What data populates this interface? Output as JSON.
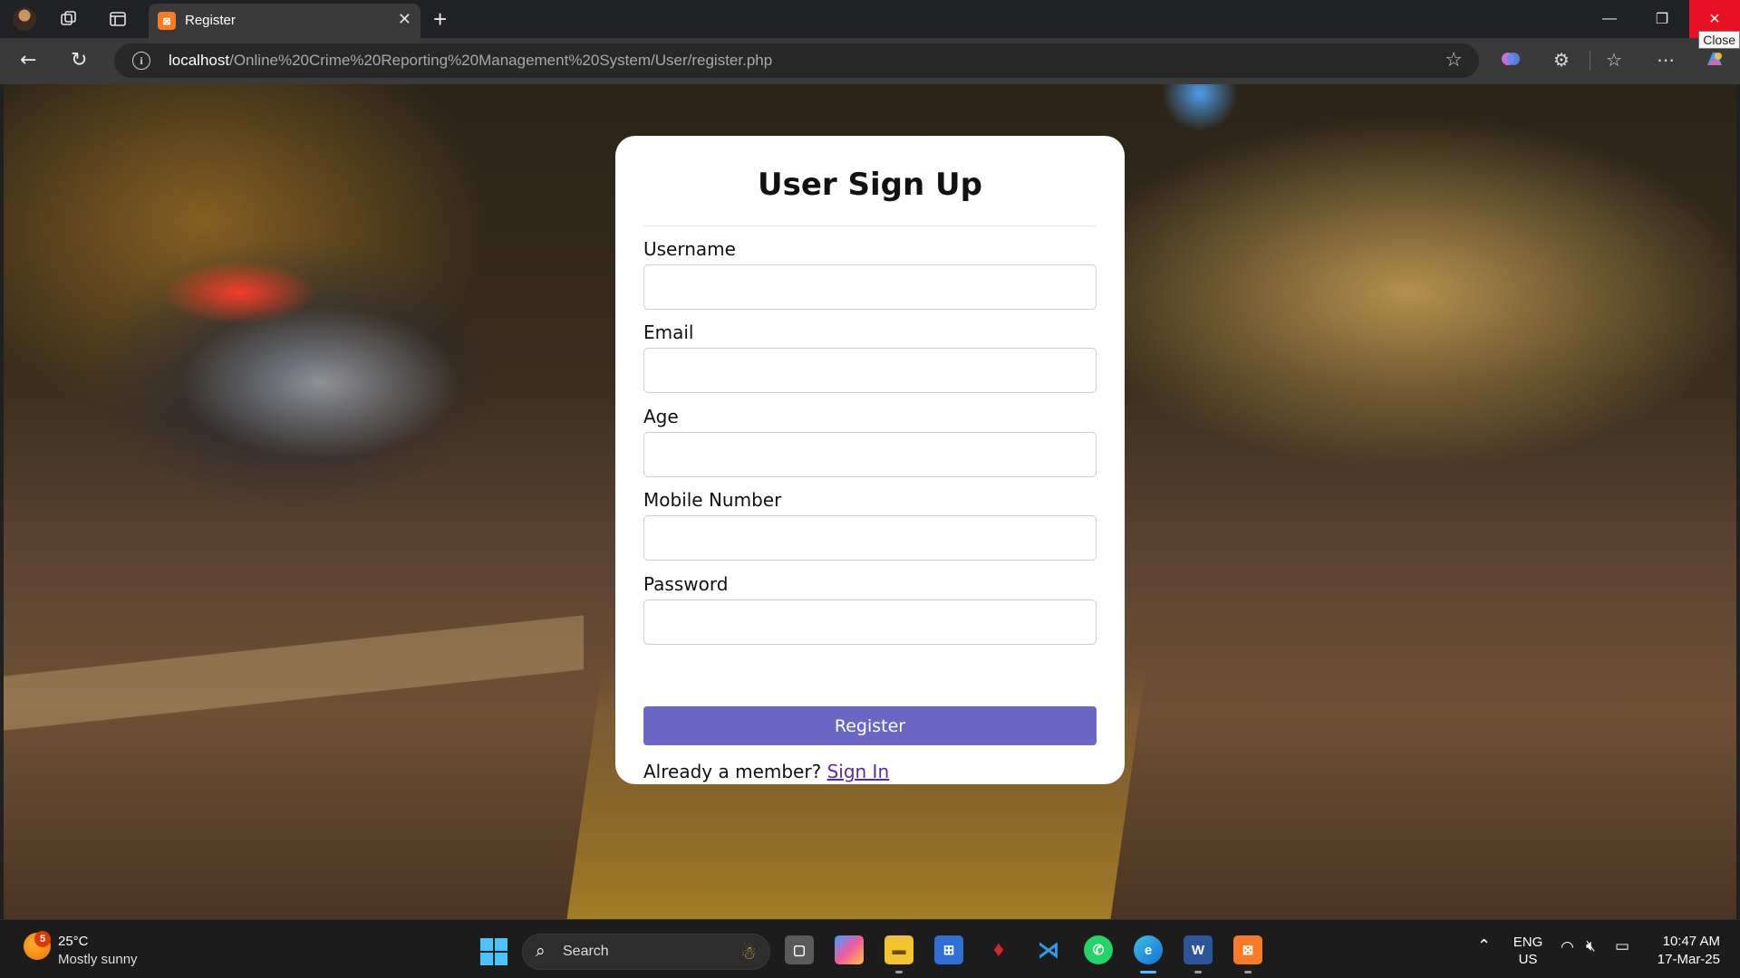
{
  "browser": {
    "tab_title": "Register",
    "tab_favicon": "xampp-icon",
    "close_tooltip": "Close",
    "url_host": "localhost",
    "url_path": "/Online%20Crime%20Reporting%20Management%20System/User/register.php",
    "icons": [
      "profile-avatar",
      "workspaces-icon",
      "vertical-tabs-icon",
      "back-arrow-icon",
      "refresh-icon",
      "info-icon",
      "favorite-star-icon",
      "copilot-brain-icon",
      "extensions-icon",
      "favorites-icon",
      "more-icon",
      "copilot-icon"
    ]
  },
  "form": {
    "title": "User Sign Up",
    "fields": [
      {
        "label": "Username",
        "value": ""
      },
      {
        "label": "Email",
        "value": ""
      },
      {
        "label": "Age",
        "value": ""
      },
      {
        "label": "Mobile Number",
        "value": ""
      },
      {
        "label": "Password",
        "value": ""
      }
    ],
    "submit_label": "Register",
    "signin_prompt": "Already a member?",
    "signin_link": "Sign In",
    "accent_color": "#6a66c4"
  },
  "taskbar": {
    "weather_badge": "5",
    "weather_temp": "25°C",
    "weather_desc": "Mostly sunny",
    "search_label": "Search",
    "apps": [
      "task-view",
      "copilot",
      "file-explorer",
      "microsoft-store",
      "mcafee",
      "vscode",
      "whatsapp",
      "edge",
      "word",
      "xampp"
    ],
    "lang_top": "ENG",
    "lang_bottom": "US",
    "time": "10:47 AM",
    "date": "17-Mar-25"
  }
}
